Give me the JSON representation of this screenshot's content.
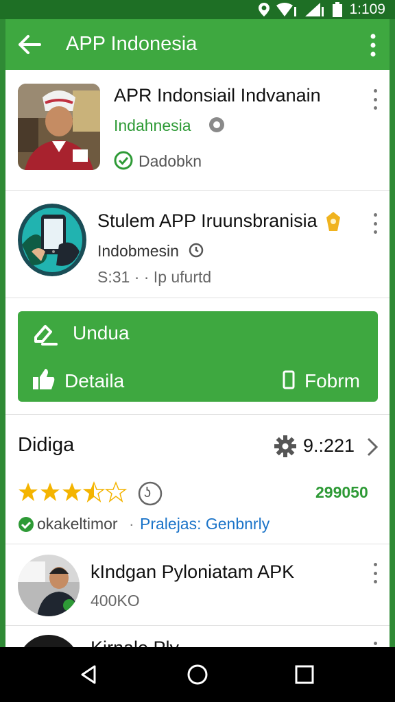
{
  "status_bar": {
    "time": "1:109"
  },
  "app_bar": {
    "title": "APP Indonesia",
    "back_icon": "arrow-left-icon",
    "menu_icon": "more-vert-icon"
  },
  "colors": {
    "primary": "#3ea840",
    "status_bar": "#1e6f25",
    "accent_text": "#2e9a36",
    "link": "#1a73c8",
    "star": "#f4b400"
  },
  "list": {
    "item1": {
      "title": "APR Indonsiail Indvanain",
      "developer": "Indahnesia",
      "status": "Dadobkn"
    },
    "item2": {
      "title": "Stulem APP Iruunsbranisia",
      "developer": "Indobmesin",
      "meta": "S:31 · · Ip ufurtd"
    }
  },
  "action_card": {
    "primary_label": "Undua",
    "details_label": "Detaila",
    "form_label": "Fobrm"
  },
  "rating_section": {
    "heading": "Didiga",
    "settings_value": "9.:221",
    "rating": 3.5,
    "rating_max": 5,
    "count": "299050",
    "badge": "ʖ",
    "developer_line": "okakeltimor",
    "category": "Pralejas: Genbnrly"
  },
  "related": {
    "item1": {
      "title": "kIndgan Pyloniatam APK",
      "size": "400KO"
    },
    "item2": {
      "title": "Kirnale Ply"
    }
  }
}
